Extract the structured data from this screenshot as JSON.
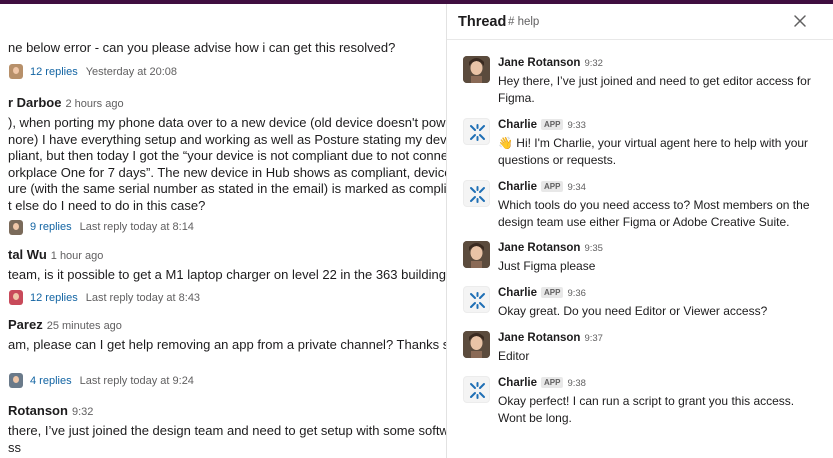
{
  "channel": {
    "messages": [
      {
        "lines": [
          "ne below error - can you please advise how i can get this resolved?"
        ],
        "replies": {
          "count": "12 replies",
          "last": "Yesterday at 20:08",
          "avatar_color": "#b7906a"
        }
      },
      {
        "name": "r Darboe",
        "time": "2 hours ago",
        "lines": [
          "), when porting my phone data over to a new device (old device doesn't power on",
          "nore) I have everything setup and working as well as Posture stating my device is",
          "pliant, but then today I got the “your device is not compliant due to not connecting",
          "orkplace One for 7 days”. The new device in Hub shows as compliant, device entry in",
          "ure (with the same serial number as stated in the email) is marked as compliant…",
          "t else do I need to do in this case?"
        ],
        "replies": {
          "count": "9 replies",
          "last": "Last reply today at 8:14",
          "avatar_color": "#7a6a5a"
        }
      },
      {
        "name": "tal Wu",
        "time": "1 hour ago",
        "lines": [
          "team, is it possible to get a M1 laptop charger on level 22 in the 363 building?"
        ],
        "replies": {
          "count": "12 replies",
          "last": "Last reply today at 8:43",
          "avatar_color": "#c84a5a"
        }
      },
      {
        "name": "Parez",
        "time": "25 minutes ago",
        "lines": [
          "am, please can I get help removing an app from a private channel? Thanks so much"
        ],
        "replies": {
          "count": "4 replies",
          "last": "Last reply today at 9:24",
          "avatar_color": "#6a7a8a"
        }
      },
      {
        "name": "Rotanson",
        "time": "9:32",
        "lines": [
          "there, I’ve just joined the design team and need to get setup with some software",
          "ss"
        ]
      }
    ]
  },
  "thread": {
    "title": "Thread",
    "channel": "# help",
    "close_icon": "close-icon",
    "messages": [
      {
        "author": "Jane Rotanson",
        "time": "9:32",
        "bot": false,
        "text": "Hey there, I’ve just joined and need to get editor access for Figma."
      },
      {
        "author": "Charlie",
        "app_badge": "APP",
        "time": "9:33",
        "bot": true,
        "emoji": "👋",
        "text": "Hi! I'm Charlie, your virtual agent here to help with your questions or requests."
      },
      {
        "author": "Charlie",
        "app_badge": "APP",
        "time": "9:34",
        "bot": true,
        "text": "Which tools do you need access to? Most members on the design team use either Figma or Adobe Creative Suite."
      },
      {
        "author": "Jane Rotanson",
        "time": "9:35",
        "bot": false,
        "text": "Just Figma please"
      },
      {
        "author": "Charlie",
        "app_badge": "APP",
        "time": "9:36",
        "bot": true,
        "text": "Okay great. Do you need Editor or Viewer access?"
      },
      {
        "author": "Jane Rotanson",
        "time": "9:37",
        "bot": false,
        "text": "Editor"
      },
      {
        "author": "Charlie",
        "app_badge": "APP",
        "time": "9:38",
        "bot": true,
        "text": "Okay perfect! I can run a script to grant you this access. Wont be long."
      }
    ]
  },
  "colors": {
    "topbar": "#3f0e40",
    "link": "#1264a3",
    "charlie_logo": "#1f6fb5"
  }
}
